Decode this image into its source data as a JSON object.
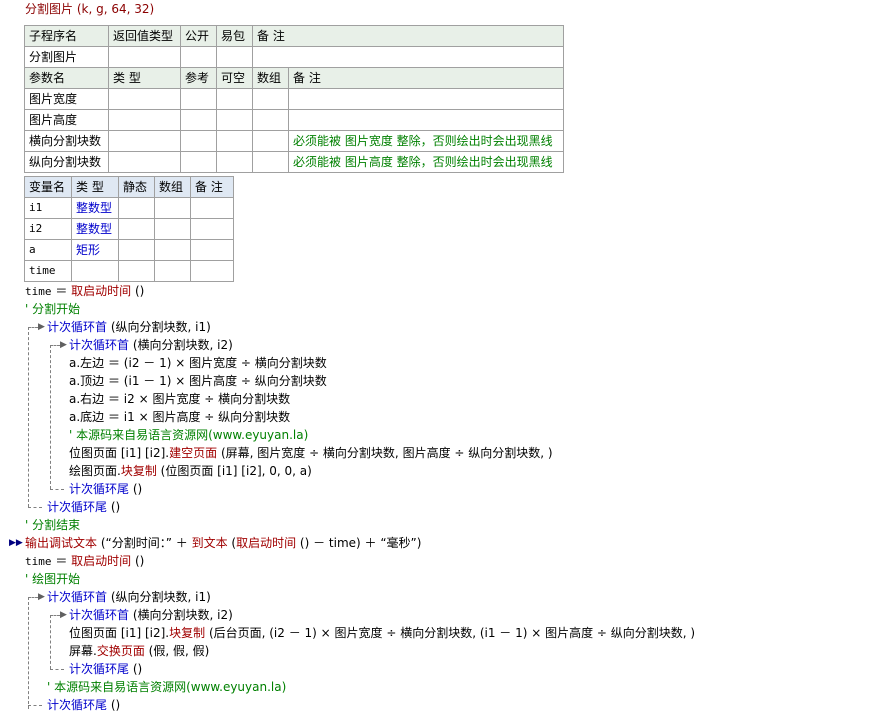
{
  "header": {
    "title": "分割图片 (k, g, 64, 32)"
  },
  "sub_table": {
    "headers": [
      "子程序名",
      "返回值类型",
      "公开",
      "易包",
      "备 注"
    ],
    "row": [
      "分割图片",
      "",
      "",
      "",
      ""
    ]
  },
  "param_table": {
    "headers": [
      "参数名",
      "类 型",
      "参考",
      "可空",
      "数组",
      "备 注"
    ],
    "rows": [
      [
        "图片宽度",
        "",
        "",
        "",
        "",
        ""
      ],
      [
        "图片高度",
        "",
        "",
        "",
        "",
        ""
      ],
      [
        "横向分割块数",
        "",
        "",
        "",
        "",
        "必须能被 图片宽度 整除，否则绘出时会出现黑线"
      ],
      [
        "纵向分割块数",
        "",
        "",
        "",
        "",
        "必须能被 图片高度 整除，否则绘出时会出现黑线"
      ]
    ]
  },
  "var_table": {
    "headers": [
      "变量名",
      "类 型",
      "静态",
      "数组",
      "备 注"
    ],
    "rows": [
      [
        "i1",
        "整数型",
        "",
        "",
        ""
      ],
      [
        "i2",
        "整数型",
        "",
        "",
        ""
      ],
      [
        "a",
        "矩形",
        "",
        "",
        ""
      ],
      [
        "time",
        "",
        "",
        "",
        ""
      ]
    ]
  },
  "code": {
    "l1a": "time",
    "l1b": " ＝ ",
    "l1c": "取启动时间",
    "l1d": " ()",
    "l2": "' 分割开始",
    "l3a": "计次循环首",
    "l3b": " (纵向分割块数, i1)",
    "l4a": "计次循环首",
    "l4b": " (横向分割块数, i2)",
    "l5": "a.左边 ＝ (i2 － 1) × 图片宽度 ÷ 横向分割块数",
    "l6": "a.顶边 ＝ (i1 － 1) × 图片高度 ÷ 纵向分割块数",
    "l7": "a.右边 ＝ i2 × 图片宽度 ÷ 横向分割块数",
    "l8": "a.底边 ＝ i1 × 图片高度 ÷ 纵向分割块数",
    "l9": "' 本源码来自易语言资源网(www.eyuyan.la)",
    "l10a": "位图页面 [i1] [i2].",
    "l10b": "建空页面",
    "l10c": " (屏幕, 图片宽度 ÷ 横向分割块数, 图片高度 ÷ 纵向分割块数, )",
    "l11a": "绘图页面.",
    "l11b": "块复制",
    "l11c": " (位图页面 [i1] [i2], 0, 0, a)",
    "l12a": "计次循环尾",
    "l12b": " ()",
    "l13a": "计次循环尾",
    "l13b": " ()",
    "l14": "' 分割结束",
    "l15a": "输出调试文本",
    "l15b": " (“分割时间：” ＋ ",
    "l15c": "到文本",
    "l15d": " (",
    "l15e": "取启动时间",
    "l15f": " () － time) ＋ “毫秒”)",
    "l16a": "time",
    "l16b": " ＝ ",
    "l16c": "取启动时间",
    "l16d": " ()",
    "l17": "' 绘图开始",
    "l18a": "计次循环首",
    "l18b": " (纵向分割块数, i1)",
    "l19a": "计次循环首",
    "l19b": " (横向分割块数, i2)",
    "l20a": "位图页面 [i1] [i2].",
    "l20b": "块复制",
    "l20c": " (后台页面, (i2 － 1) × 图片宽度 ÷ 横向分割块数, (i1 － 1) × 图片高度 ÷ 纵向分割块数, )",
    "l21a": "屏幕.",
    "l21b": "交换页面",
    "l21c": " (假, 假, 假)",
    "l22a": "计次循环尾",
    "l22b": " ()",
    "l23": "' 本源码来自易语言资源网(www.eyuyan.la)",
    "l24a": "计次循环尾",
    "l24b": " ()"
  }
}
